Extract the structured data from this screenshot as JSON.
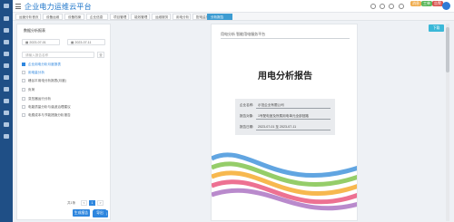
{
  "app": {
    "title": "企业电力运维云平台"
  },
  "header": {
    "badges": [
      {
        "text": "消息",
        "color": "#f0ad4e"
      },
      {
        "text": "工单",
        "color": "#5cb85c"
      },
      {
        "text": "告警",
        "color": "#d9534f"
      }
    ]
  },
  "tabs": [
    {
      "label": "运营分析首页"
    },
    {
      "label": "设备运维"
    },
    {
      "label": "设备档案"
    },
    {
      "label": "企业信息"
    },
    {
      "label": "项目管理"
    },
    {
      "label": "能效管理"
    },
    {
      "label": "运维服务"
    },
    {
      "label": "用电分析"
    },
    {
      "label": "配电监测"
    },
    {
      "label": "分析报告"
    },
    {
      "label": "用户报告"
    }
  ],
  "panel": {
    "title": "数据分析报表",
    "start_date": "2023-07-01",
    "end_date": "2023-07-11",
    "search_placeholder": "请输入报告名称",
    "search_btn": "查",
    "options": [
      {
        "label": "企业用电分析月度报表",
        "checked": true,
        "blue": true
      },
      {
        "label": "用电量分析",
        "checked": false,
        "blue": true
      },
      {
        "label": "峰谷平用电分析报表(月度)",
        "checked": false,
        "blue": false
      },
      {
        "label": "负荷",
        "checked": false,
        "blue": false
      },
      {
        "label": "变压器运行分析",
        "checked": false,
        "blue": false
      },
      {
        "label": "电能质量分析与谐波治理建议",
        "checked": false,
        "blue": false
      },
      {
        "label": "电费成本与节能措施分析报告",
        "checked": false,
        "blue": false
      }
    ],
    "pagination": {
      "prev": "<",
      "current": "1",
      "next": ">",
      "total_label": "共1条"
    },
    "btn_generate": "生成报告",
    "btn_export": "导出"
  },
  "doc": {
    "header_text": "用电分析  智能用电服务平台",
    "title": "用电分析报告",
    "info": [
      {
        "label": "企业名称:",
        "value": "示范企业有限公司"
      },
      {
        "label": "报告对象:",
        "value": "1号配电室及所属用电单元全部回路"
      },
      {
        "label": "报告日期:",
        "value": "2023-07-01 至 2023-07-11"
      }
    ]
  },
  "right": {
    "btn": "下载"
  }
}
